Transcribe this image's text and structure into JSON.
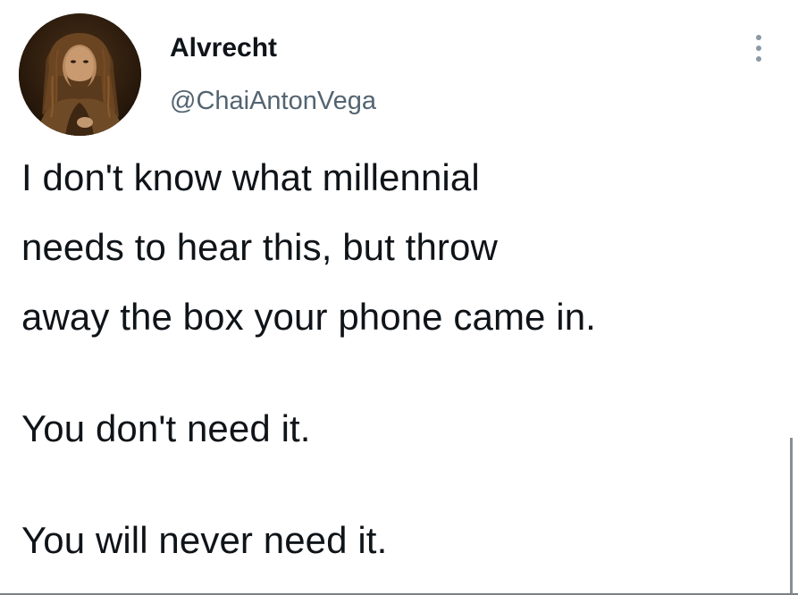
{
  "author": {
    "display_name": "Alvrecht",
    "handle": "@ChaiAntonVega",
    "avatar_icon": "portrait-avatar"
  },
  "menu": {
    "icon": "more-vertical-icon"
  },
  "tweet": {
    "lines": [
      "I don't know what millennial",
      "needs to hear this, but throw",
      "away the box your phone came in."
    ],
    "paragraph2": "You don't need it.",
    "paragraph3": "You will never need it."
  },
  "colors": {
    "text_primary": "#0f1419",
    "text_secondary": "#536471",
    "background": "#ffffff"
  }
}
